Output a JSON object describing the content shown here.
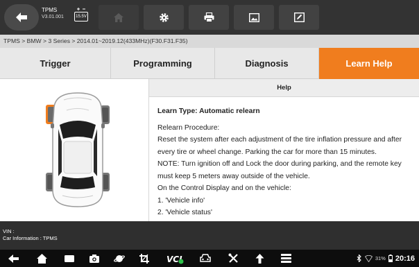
{
  "app": {
    "title": "TPMS",
    "version": "V3.01.001",
    "battery_voltage": "15.5V"
  },
  "toolbar": {
    "home_icon": "home-icon",
    "settings_icon": "gear-icon",
    "print_icon": "printer-icon",
    "screenshot_icon": "image-icon",
    "edit_icon": "edit-icon"
  },
  "breadcrumb": "TPMS > BMW > 3 Series > 2014.01~2019.12(433MHz)(F30.F31.F35)",
  "tabs": [
    {
      "label": "Trigger",
      "active": false
    },
    {
      "label": "Programming",
      "active": false
    },
    {
      "label": "Diagnosis",
      "active": false
    },
    {
      "label": "Learn Help",
      "active": true
    }
  ],
  "help": {
    "header": "Help",
    "learn_type": "Learn Type:  Automatic relearn",
    "lines": [
      "Relearn Procedure:",
      "Reset the system after each adjustment of the tire inflation pressure and after",
      "every tire or wheel change. Parking the car for more than 15 minutes.",
      "NOTE: Turn ignition off and Lock the door during parking, and the remote key",
      "must keep 5 meters away outside of the vehicle.",
      "On the Control Display and on the vehicle:",
      "1. 'Vehicle info'",
      "2. 'Vehicle status'"
    ]
  },
  "info": {
    "vin": "VIN :",
    "car_information": "Car Information : TPMS"
  },
  "status": {
    "battery_percent": "31%",
    "time": "20:16"
  },
  "colors": {
    "accent": "#f07d1e",
    "topbar": "#333333",
    "navbar": "#0d0d0d"
  }
}
